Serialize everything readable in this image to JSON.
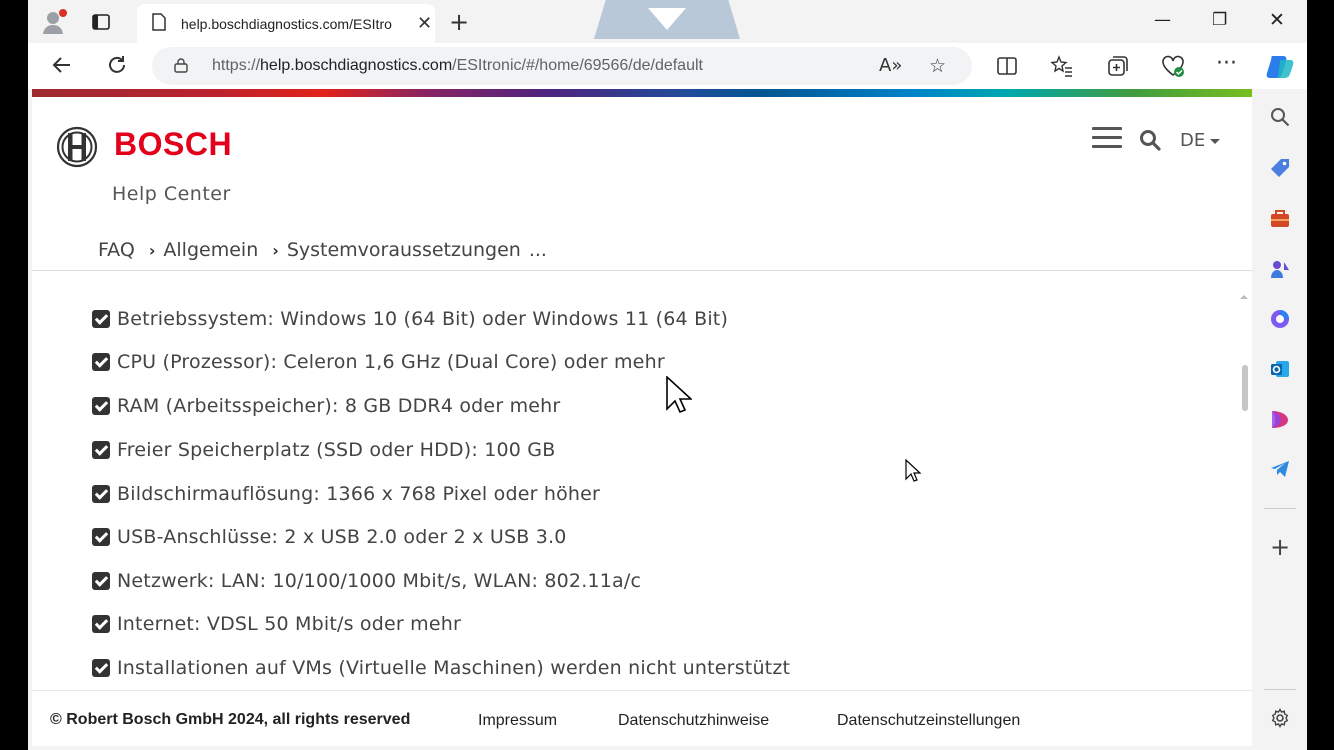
{
  "browser": {
    "tab_title": "help.boschdiagnostics.com/ESItro",
    "url_prefix": "https://",
    "url_host": "help.boschdiagnostics.com",
    "url_path": "/ESItronic/#/home/69566/de/default",
    "read_aloud_label": "A»"
  },
  "header": {
    "brand": "BOSCH",
    "subtitle": "Help Center",
    "language": "DE"
  },
  "breadcrumb": {
    "items": [
      "FAQ",
      "Allgemein",
      "Systemvoraussetzungen"
    ],
    "ellipsis": "..."
  },
  "requirements": [
    "Betriebssystem: Windows 10 (64 Bit) oder Windows 11 (64 Bit)",
    "CPU (Prozessor): Celeron 1,6 GHz (Dual Core) oder mehr",
    "RAM (Arbeitsspeicher): 8 GB DDR4 oder mehr",
    "Freier Speicherplatz (SSD oder HDD): 100 GB",
    "Bildschirmauflösung: 1366 x 768 Pixel oder höher",
    "USB-Anschlüsse: 2 x USB 2.0 oder 2 x USB 3.0",
    "Netzwerk: LAN: 10/100/1000 Mbit/s, WLAN: 802.11a/c",
    "Internet: VDSL 50 Mbit/s oder mehr",
    "Installationen auf VMs (Virtuelle Maschinen) werden nicht unterstützt"
  ],
  "footer": {
    "copyright": "© Robert Bosch GmbH 2024, all rights reserved",
    "impressum": "Impressum",
    "privacy_notice": "Datenschutzhinweise",
    "privacy_settings": "Datenschutzeinstellungen"
  },
  "colors": {
    "brand_red": "#e2001a",
    "text": "#444444"
  }
}
